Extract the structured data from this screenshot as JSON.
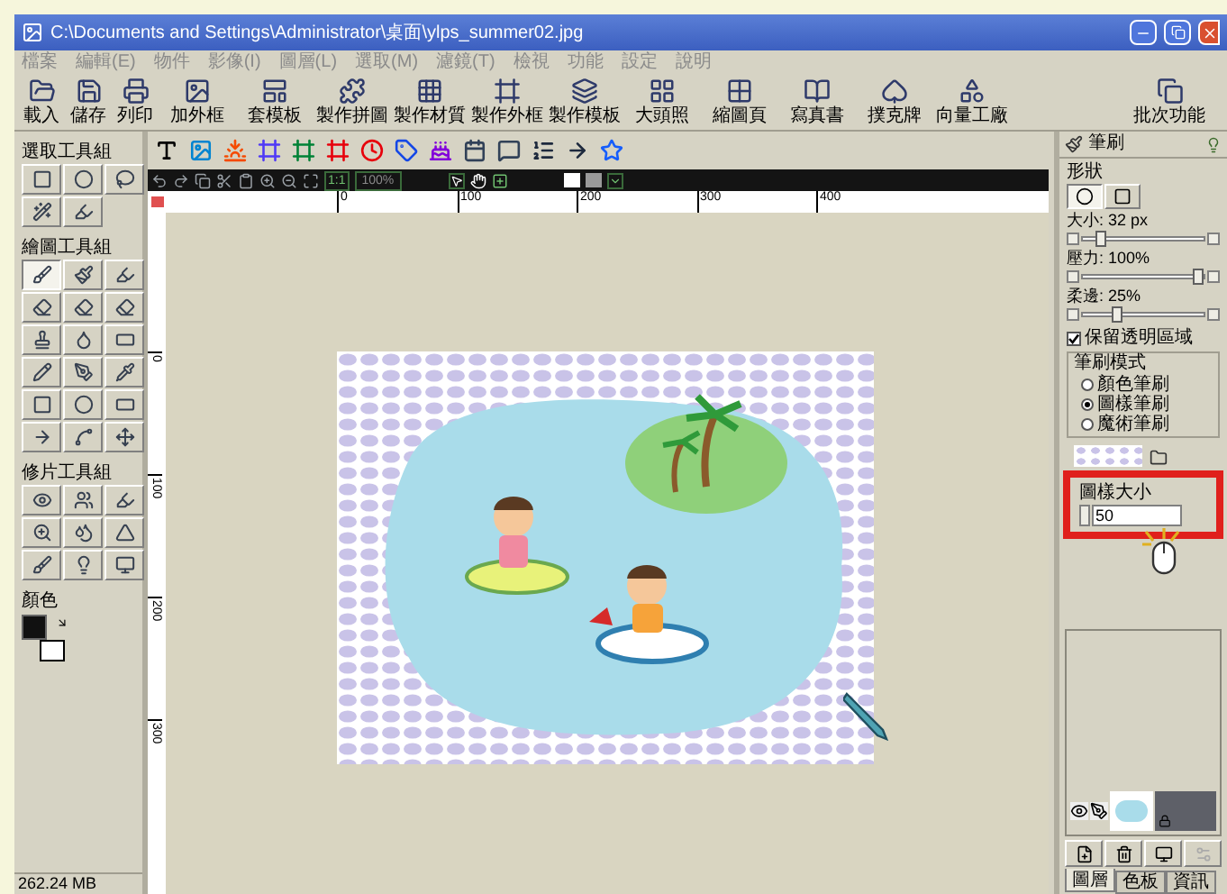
{
  "window": {
    "title": "C:\\Documents and Settings\\Administrator\\桌面\\ylps_summer02.jpg"
  },
  "menu": [
    "檔案",
    "編輯(E)",
    "物件",
    "影像(I)",
    "圖層(L)",
    "選取(M)",
    "濾鏡(T)",
    "檢視",
    "功能",
    "設定",
    "說明"
  ],
  "toolbar": [
    {
      "label": "載入"
    },
    {
      "label": "儲存"
    },
    {
      "label": "列印"
    },
    {
      "label": "加外框"
    },
    {
      "label": "套模板"
    },
    {
      "label": "製作拼圖"
    },
    {
      "label": "製作材質"
    },
    {
      "label": "製作外框"
    },
    {
      "label": "製作模板"
    },
    {
      "label": "大頭照"
    },
    {
      "label": "縮圖頁"
    },
    {
      "label": "寫真書"
    },
    {
      "label": "撲克牌"
    },
    {
      "label": "向量工廠"
    },
    {
      "label": "批次功能"
    }
  ],
  "left_panel": {
    "groups": [
      {
        "label": "選取工具組",
        "tools": [
          {
            "selected": false
          },
          {
            "selected": false
          },
          {
            "selected": false
          },
          {
            "selected": false
          },
          {
            "selected": false
          }
        ]
      },
      {
        "label": "繪圖工具組",
        "tools": [
          {
            "selected": true
          },
          {
            "selected": false
          },
          {
            "selected": false
          },
          {
            "selected": false
          },
          {
            "selected": false
          },
          {
            "selected": false
          },
          {
            "selected": false
          },
          {
            "selected": false
          },
          {
            "selected": false
          },
          {
            "selected": false
          },
          {
            "selected": false
          },
          {
            "selected": false
          },
          {
            "selected": false
          },
          {
            "selected": false
          },
          {
            "selected": false
          },
          {
            "selected": false
          },
          {
            "selected": false
          },
          {
            "selected": false
          }
        ]
      },
      {
        "label": "修片工具組",
        "tools": [
          {
            "selected": false
          },
          {
            "selected": false
          },
          {
            "selected": false
          },
          {
            "selected": false
          },
          {
            "selected": false
          },
          {
            "selected": false
          },
          {
            "selected": false
          },
          {
            "selected": false
          },
          {
            "selected": false
          }
        ]
      }
    ],
    "color_label": "顏色",
    "status": "262.24 MB"
  },
  "view_bar": {
    "fit_label": "1:1",
    "zoom": "100%"
  },
  "ruler": {
    "h": [
      "0",
      "100",
      "200",
      "300",
      "400"
    ],
    "v": [
      "0",
      "100",
      "200",
      "300"
    ]
  },
  "brush_panel": {
    "title": "筆刷",
    "shape_label": "形狀",
    "shapes": [
      {
        "kind": "circle",
        "selected": true
      },
      {
        "kind": "rectangle",
        "selected": false
      }
    ],
    "sliders": [
      {
        "label": "大小: 32 px",
        "level": 0.15
      },
      {
        "label": "壓力: 100%",
        "level": 0.95
      },
      {
        "label": "柔邊: 25%",
        "level": 0.28
      }
    ],
    "preserve": {
      "label": "保留透明區域",
      "checked": true
    },
    "mode": {
      "label": "筆刷模式",
      "options": [
        {
          "label": "顏色筆刷",
          "selected": false
        },
        {
          "label": "圖樣筆刷",
          "selected": true
        },
        {
          "label": "魔術筆刷",
          "selected": false
        }
      ]
    },
    "pattern_size": {
      "label": "圖樣大小",
      "value": "50"
    }
  },
  "layer_tabs": [
    {
      "label": "圖層",
      "selected": true
    },
    {
      "label": "色板",
      "selected": false
    },
    {
      "label": "資訊",
      "selected": false
    }
  ]
}
